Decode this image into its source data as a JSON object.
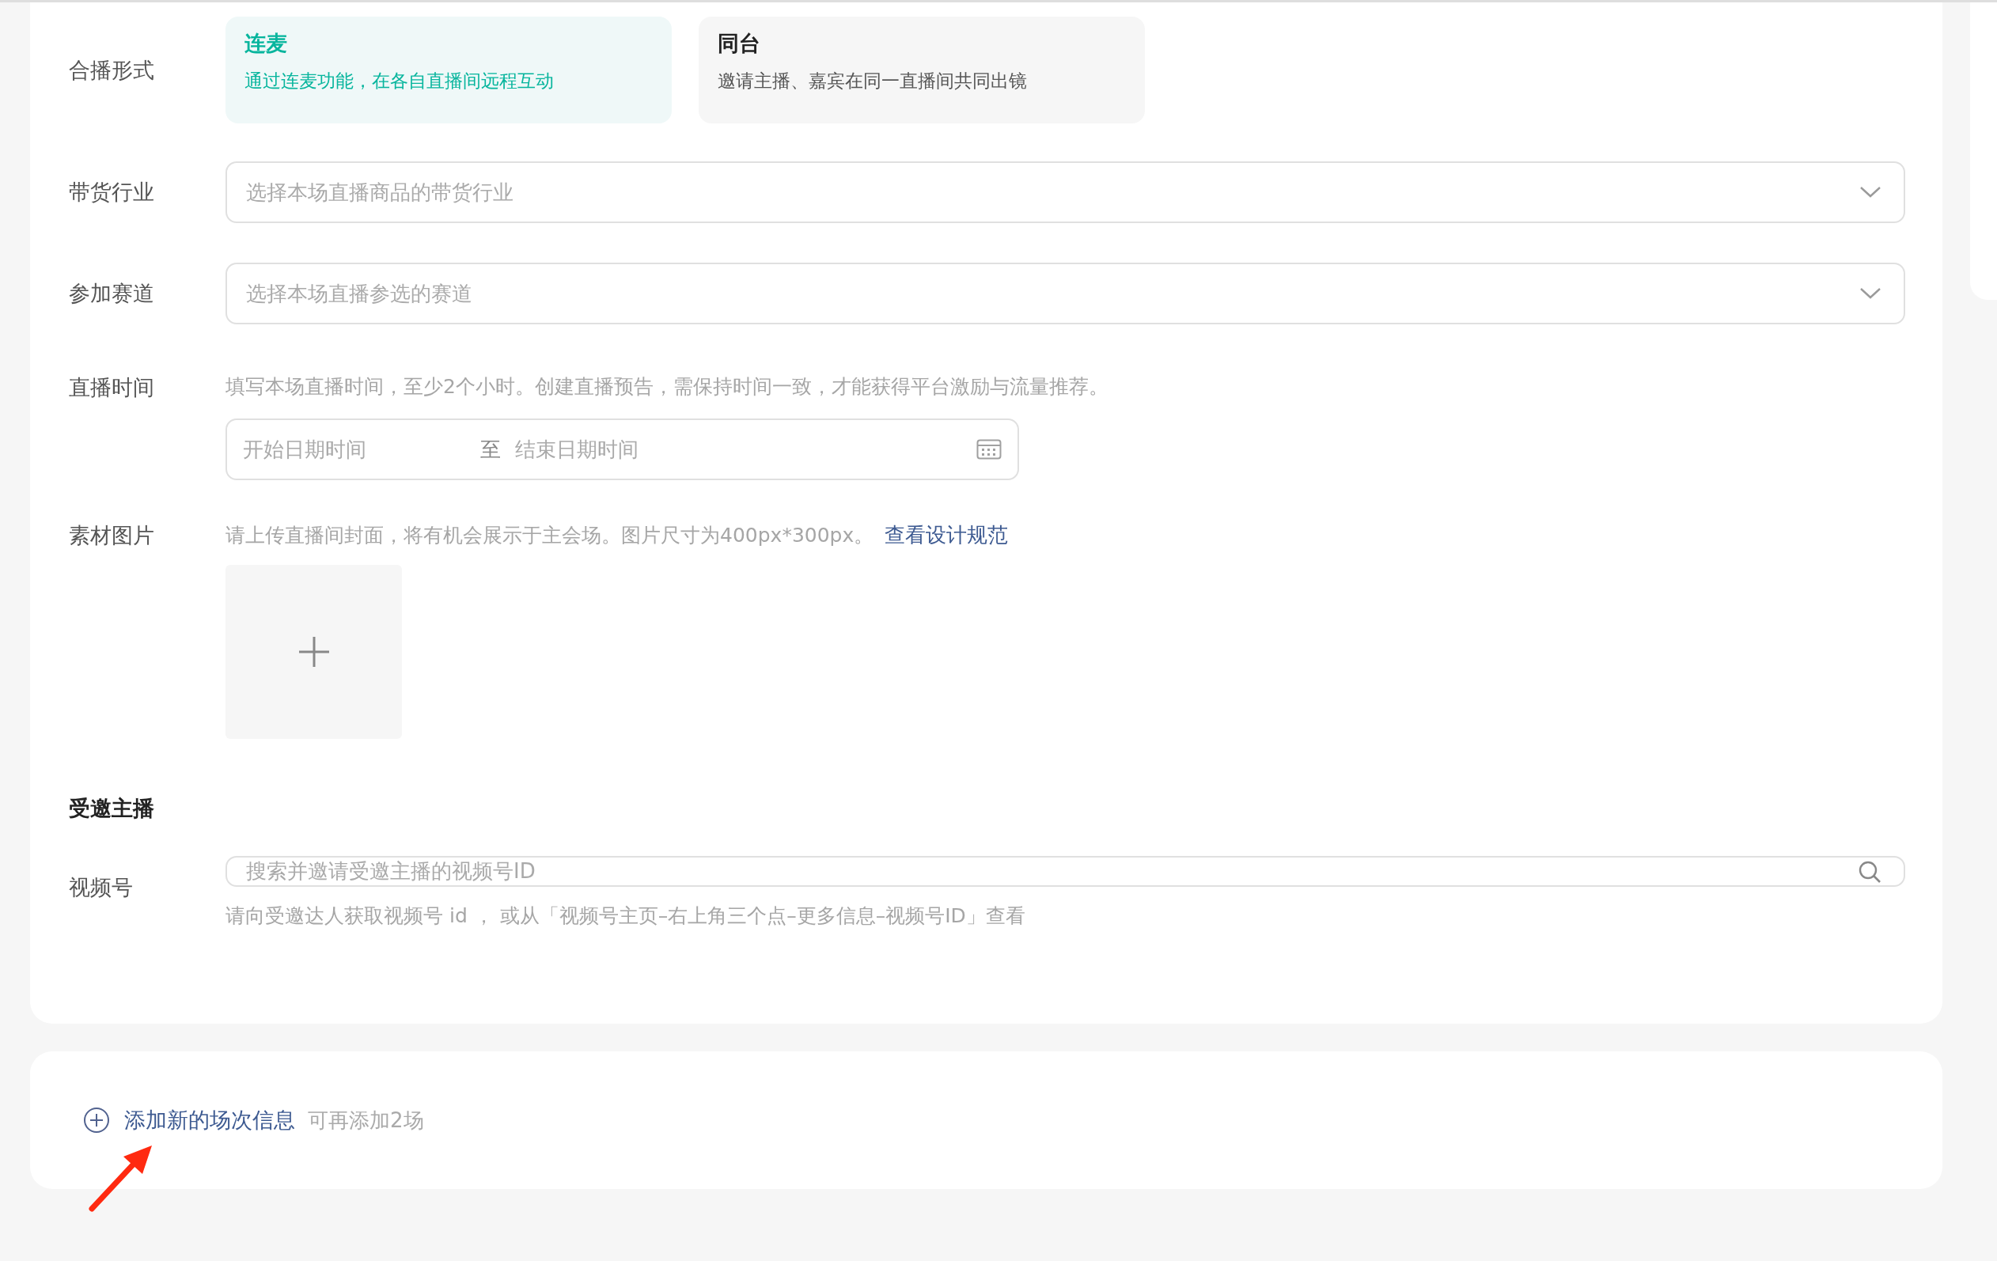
{
  "broadcast_mode": {
    "label": "合播形式",
    "options": [
      {
        "title": "连麦",
        "description": "通过连麦功能，在各自直播间远程互动",
        "selected": true
      },
      {
        "title": "同台",
        "description": "邀请主播、嘉宾在同一直播间共同出镜",
        "selected": false
      }
    ]
  },
  "industry": {
    "label": "带货行业",
    "placeholder": "选择本场直播商品的带货行业"
  },
  "track": {
    "label": "参加赛道",
    "placeholder": "选择本场直播参选的赛道"
  },
  "live_time": {
    "label": "直播时间",
    "hint": "填写本场直播时间，至少2个小时。创建直播预告，需保持时间一致，才能获得平台激励与流量推荐。",
    "start_placeholder": "开始日期时间",
    "separator": "至",
    "end_placeholder": "结束日期时间"
  },
  "material": {
    "label": "素材图片",
    "hint": "请上传直播间封面，将有机会展示于主会场。图片尺寸为400px*300px。",
    "link": "查看设计规范"
  },
  "invited_host": {
    "heading": "受邀主播",
    "label": "视频号",
    "placeholder": "搜索并邀请受邀主播的视频号ID",
    "hint": "请向受邀达人获取视频号 id ， 或从「视频号主页–右上角三个点–更多信息–视频号ID」查看"
  },
  "add_session": {
    "link": "添加新的场次信息",
    "note": "可再添加2场"
  }
}
